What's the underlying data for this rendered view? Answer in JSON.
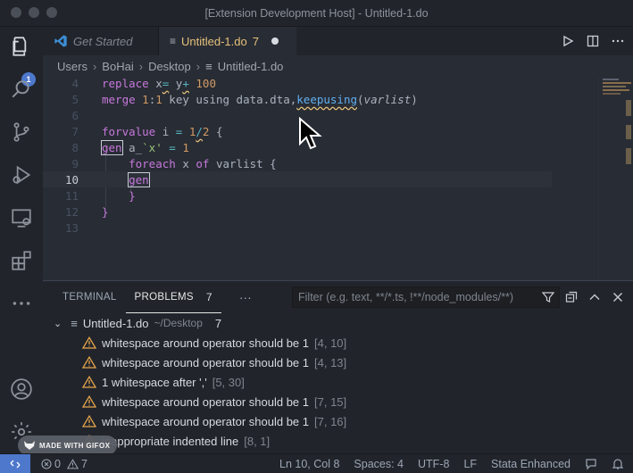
{
  "window": {
    "title": "[Extension Development Host] - Untitled-1.do"
  },
  "tabs": [
    {
      "label": "Get Started",
      "active": false
    },
    {
      "label": "Untitled-1.do",
      "count": "7",
      "active": true
    }
  ],
  "breadcrumb": [
    "Users",
    "BoHai",
    "Desktop",
    "Untitled-1.do"
  ],
  "activity": {
    "explorer_badge": "1"
  },
  "editor": {
    "line_numbers": [
      "4",
      "5",
      "6",
      "7",
      "8",
      "9",
      "10",
      "11",
      "12",
      "13"
    ],
    "current_line": "10"
  },
  "panel": {
    "tabs": [
      {
        "label": "TERMINAL"
      },
      {
        "label": "PROBLEMS",
        "badge": "7"
      }
    ],
    "filter_placeholder": "Filter (e.g. text, **/*.ts, !**/node_modules/**)",
    "file": {
      "name": "Untitled-1.do",
      "path": "~/Desktop",
      "count": "7"
    },
    "problems": [
      {
        "message": "whitespace around operator should be 1",
        "location": "[4, 10]"
      },
      {
        "message": "whitespace around operator should be 1",
        "location": "[4, 13]"
      },
      {
        "message": "1 whitespace after ','",
        "location": "[5, 30]"
      },
      {
        "message": "whitespace around operator should be 1",
        "location": "[7, 15]"
      },
      {
        "message": "whitespace around operator should be 1",
        "location": "[7, 16]"
      },
      {
        "message": "inappropriate indented line",
        "location": "[8, 1]"
      }
    ]
  },
  "statusbar": {
    "errors": "0",
    "warnings": "7",
    "position": "Ln 10, Col 8",
    "spaces": "Spaces: 4",
    "encoding": "UTF-8",
    "eol": "LF",
    "language": "Stata Enhanced"
  },
  "watermark": {
    "text": "MADE WITH GIFOX"
  },
  "colors": {
    "accent": "#4d78cc",
    "warning": "#e5c07b",
    "keyword": "#c678dd",
    "number": "#d19a66"
  }
}
